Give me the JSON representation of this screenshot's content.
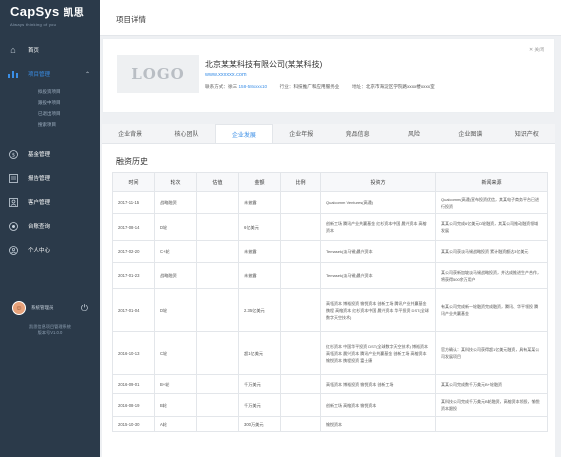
{
  "brand": {
    "name": "CapSys",
    "name_cn": "凯思",
    "tagline": "Always thinking of you"
  },
  "nav": {
    "items": [
      {
        "label": "首页",
        "icon": "home-icon"
      },
      {
        "label": "项目管理",
        "icon": "chart-icon",
        "active": true
      },
      {
        "label": "基金管理",
        "icon": "fund-icon"
      },
      {
        "label": "报告管理",
        "icon": "report-icon"
      },
      {
        "label": "客户管理",
        "icon": "user-icon"
      },
      {
        "label": "台账查询",
        "icon": "query-icon"
      },
      {
        "label": "个人中心",
        "icon": "profile-icon"
      }
    ],
    "sub_items": [
      "拟投资项目",
      "跟投中项目",
      "已退出项目",
      "搜索项目"
    ]
  },
  "user": {
    "name": "系统管理员"
  },
  "system": {
    "line1": "凯思信息项目管理系统",
    "line2": "版本号V1.0.0"
  },
  "page": {
    "title": "项目详情"
  },
  "company": {
    "logo": "LOGO",
    "name": "北京某某科技有限公司(某某科技)",
    "url": "www.xxxxxx.com",
    "contact_label": "联系方式：",
    "contact_name": "徐三",
    "contact_phone": "158-58xxxx10",
    "industry_label": "行业：",
    "industry": "科技推广和应用服务业",
    "address_label": "地址：",
    "address": "北京市海淀区学院路xxxx楼xxxx室",
    "close": "✕ 关闭"
  },
  "tabs": [
    "企业背景",
    "核心团队",
    "企业发展",
    "企业年报",
    "竞品信息",
    "风险",
    "企业图谱",
    "知识产权"
  ],
  "section": {
    "title": "融资历史"
  },
  "table": {
    "headers": [
      "时间",
      "轮次",
      "估值",
      "金额",
      "比例",
      "投资方",
      "新闻来源"
    ],
    "rows": [
      [
        "2017-11-15",
        "战略融资",
        "",
        "未披露",
        "",
        "Qualcomm Ventures(高通)",
        "Qualcomm(高通)宣布投资优信，其某电子商务平台已进行投资"
      ],
      [
        "2017-08-14",
        "D轮",
        "",
        "6亿美元",
        "",
        "创新工场 腾讯产业共赢基金 红杉资本中国 晨兴资本 高榕资本",
        "某某公司完成6亿美元D轮融资，其某公司推动融资领域发展"
      ],
      [
        "2017-02-20",
        "C+轮",
        "",
        "未披露",
        "",
        "Temasek(淡马锡)晨兴资本",
        "某某公司获淡马锡战略投资 累计融资额达3亿美元"
      ],
      [
        "2017-01-23",
        "战略融资",
        "",
        "未披露",
        "",
        "Temasek(淡马锡)晨兴资本",
        "某公司获新加坡淡马锡战略投资，并达成推进生产合作，将获得500余万用户"
      ],
      [
        "2017-01-04",
        "D轮",
        "",
        "2.35亿美元",
        "",
        "高瓴资本 博裕投资 愉悦资本 创新工场 腾讯产业共赢基金 携程 高榕资本 红杉资本中国 晨兴资本 华平投资 DST(全球数字天空技术)",
        "有某公司完成新一轮融资完成融资，腾讯、华平领投 腾讯产业共赢基金"
      ],
      [
        "2016-10-13",
        "C轮",
        "",
        "超1亿美元",
        "",
        "红杉资本 中国华平投资 DST(全球数字天空技术) 博裕资本 高瓴资本 晨兴资本 腾讯产业共赢基金 创新工场 高榕资本 愉悦资本 携程投资 富士康",
        "官方确认：某科技公司获得超1亿美元融资，具有某某公司发展项目"
      ],
      [
        "2016-09-01",
        "B+轮",
        "",
        "千万美元",
        "",
        "高瓴资本 博裕投资 愉悦资本 创新工场",
        "某某公司完成数千万美元B+轮融资"
      ],
      [
        "2016-08-19",
        "B轮",
        "",
        "千万美元",
        "",
        "创新工场 高榕资本 愉悦资本",
        "某科技公司完成千万美元B轮融资，高榕资本领投，愉悦资本跟投"
      ],
      [
        "2015-10-30",
        "A轮",
        "",
        "300万美元",
        "",
        "愉悦资本",
        ""
      ]
    ]
  }
}
